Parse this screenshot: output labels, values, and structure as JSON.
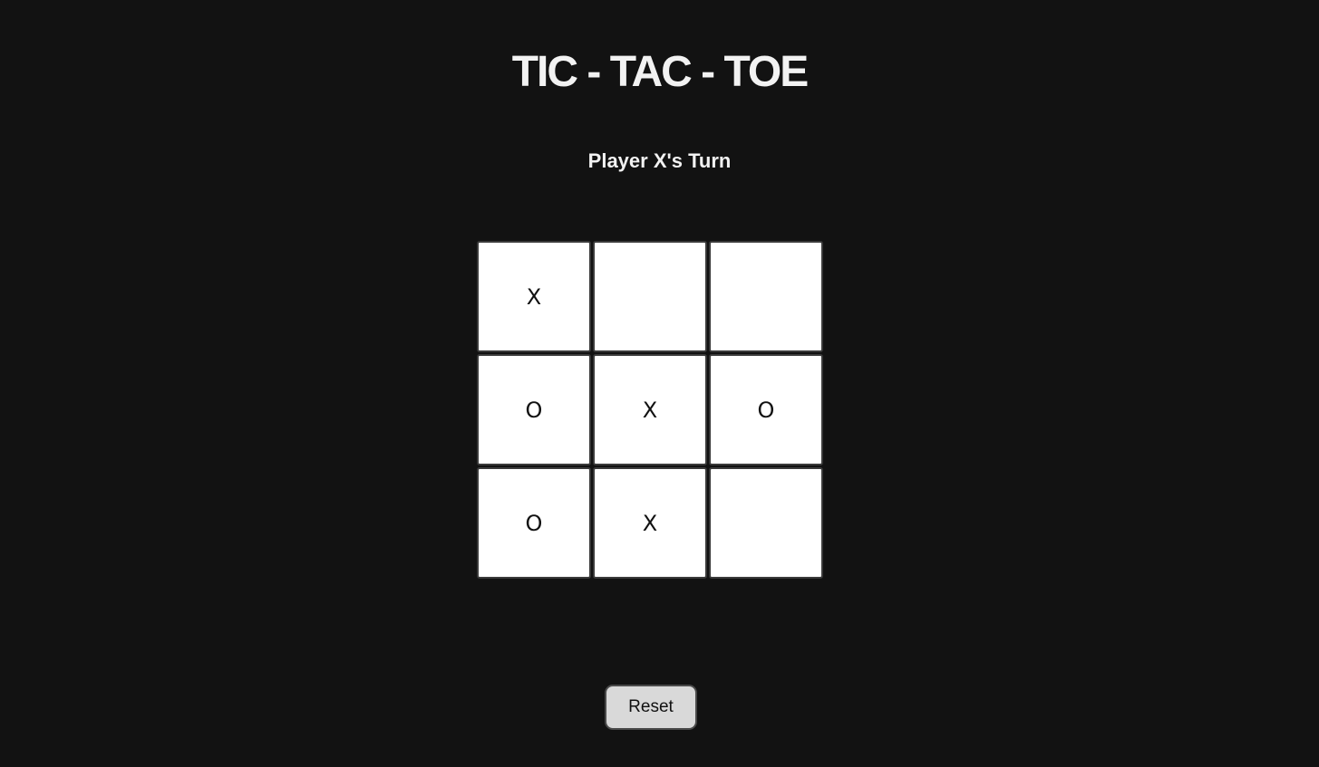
{
  "header": {
    "title": "TIC - TAC - TOE"
  },
  "status": {
    "text": "Player X's Turn"
  },
  "board": {
    "cells": [
      "X",
      "",
      "",
      "O",
      "X",
      "O",
      "O",
      "X",
      ""
    ]
  },
  "controls": {
    "reset_label": "Reset"
  },
  "colors": {
    "background": "#121212",
    "cell": "#ffffff",
    "button": "#d9d9d9"
  }
}
